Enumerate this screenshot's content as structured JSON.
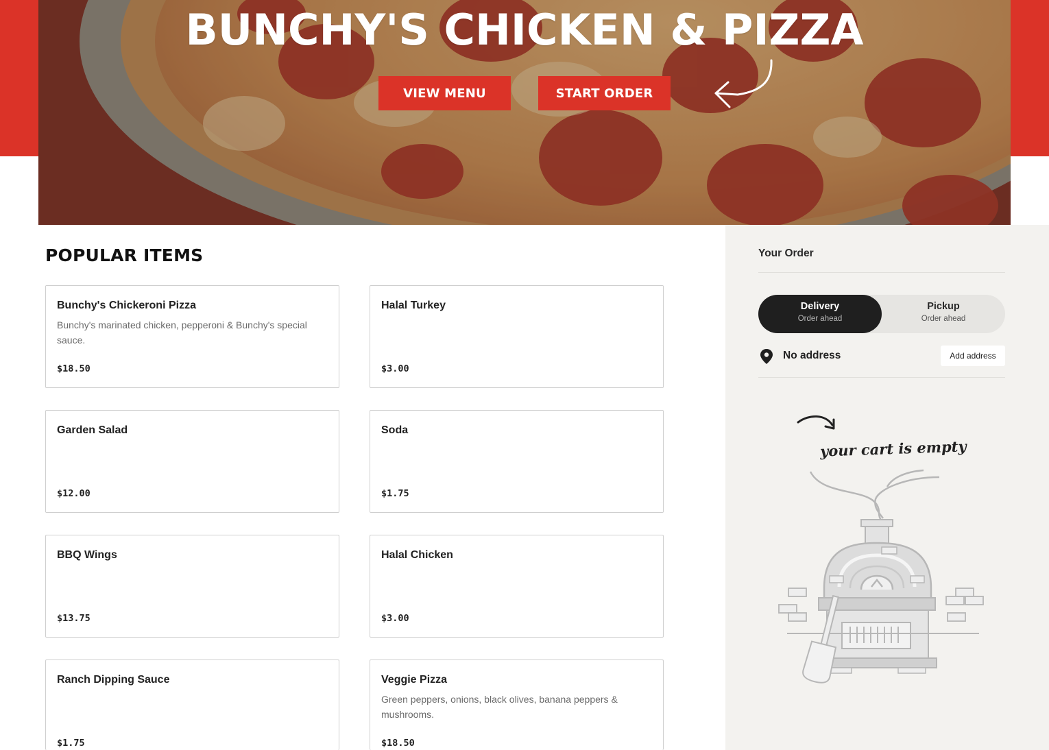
{
  "hero": {
    "title": "BUNCHY'S CHICKEN & PIZZA",
    "view_menu_label": "VIEW MENU",
    "start_order_label": "START ORDER"
  },
  "popular": {
    "heading": "POPULAR ITEMS",
    "items": [
      {
        "name": "Bunchy's Chickeroni Pizza",
        "description": "Bunchy's marinated chicken, pepperoni & Bunchy's special sauce.",
        "price": "$18.50"
      },
      {
        "name": "Halal Turkey",
        "description": "",
        "price": "$3.00"
      },
      {
        "name": "Garden Salad",
        "description": "",
        "price": "$12.00"
      },
      {
        "name": "Soda",
        "description": "",
        "price": "$1.75"
      },
      {
        "name": "BBQ Wings",
        "description": "",
        "price": "$13.75"
      },
      {
        "name": "Halal Chicken",
        "description": "",
        "price": "$3.00"
      },
      {
        "name": "Ranch Dipping Sauce",
        "description": "",
        "price": "$1.75"
      },
      {
        "name": "Veggie Pizza",
        "description": "Green peppers, onions, black olives, banana peppers & mushrooms.",
        "price": "$18.50"
      }
    ]
  },
  "order": {
    "title": "Your Order",
    "delivery_label": "Delivery",
    "delivery_sub": "Order ahead",
    "pickup_label": "Pickup",
    "pickup_sub": "Order ahead",
    "address_text": "No address",
    "add_address_label": "Add address",
    "empty_cart_text": "your cart is empty"
  },
  "colors": {
    "brand_red": "#db3328",
    "dark": "#1f1f1f",
    "panel_bg": "#f3f2ef"
  },
  "icons": [
    "curved-arrow-icon",
    "location-pin-icon",
    "pizza-oven-illustration"
  ]
}
